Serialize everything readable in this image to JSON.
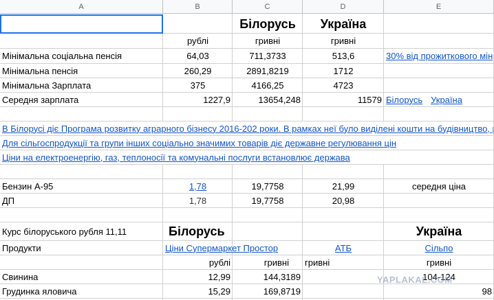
{
  "headers": [
    "A",
    "B",
    "C",
    "D",
    "E"
  ],
  "rows": {
    "r2": {
      "c": "Білорусь",
      "d": "Україна"
    },
    "r3": {
      "b": "рублі",
      "c": "гривні",
      "d": "гривні"
    },
    "r4": {
      "a": "Мінімальна соціальна пенсія",
      "b": "64,03",
      "c": "711,3733",
      "d": "513,6",
      "e": "30% від прожиткового мін"
    },
    "r5": {
      "a": "Мінімальна пенсія",
      "b": "260,29",
      "c": "2891,8219",
      "d": "1712"
    },
    "r6": {
      "a": "Мінімальна Зарплата",
      "b": "375",
      "c": "4166,25",
      "d": "4723"
    },
    "r7": {
      "a": "Середня зарплата",
      "b": "1227,9",
      "c": "13654,248",
      "d": "11579",
      "e1": "Білорусь",
      "e2": "Україна"
    },
    "r9": {
      "a": "В Білорусі діє Програма розвитку аграрного бізнесу 2016-202 роки. В рамках неї було виділені кошти на будівництво, р"
    },
    "r10": {
      "a": "Для сільгоспродукції  та групи інших соціально значимих товарів діє державне регулювання цін"
    },
    "r11": {
      "a": "Ціни на електроенергію, газ, теплоносії та комунальні послуги встановлює держава"
    },
    "r13": {
      "a": "Бензин А-95",
      "b": "1,78",
      "c": "19,7758",
      "d": "21,99",
      "e": "середня ціна"
    },
    "r14": {
      "a": "ДП",
      "b": "1,78",
      "c": "19,7758",
      "d": "20,98"
    },
    "r16": {
      "a": "Курс білоруського рубля 11,11",
      "b": "Білорусь",
      "e": "Україна"
    },
    "r17": {
      "a": "Продукти",
      "b": "Ціни  Супермаркет Простор",
      "d": "АТБ",
      "e": "Сільпо"
    },
    "r18": {
      "b": "рублі",
      "c": "гривні",
      "c2": "гривні",
      "e": "гривні"
    },
    "r19": {
      "a": "Свинина",
      "b": "12,99",
      "c": "144,3189",
      "e": "104-124"
    },
    "r20": {
      "a": "Грудинка яловича",
      "b": "15,29",
      "c": "169,8719",
      "e": "98"
    }
  },
  "watermark": "YAPLAKAL.COM"
}
